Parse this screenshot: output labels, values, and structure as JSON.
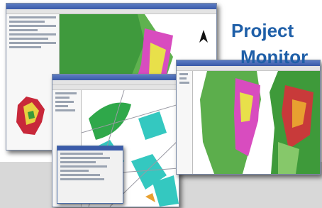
{
  "title": {
    "line1": "Project",
    "line2": "Monitor"
  },
  "colors": {
    "title": "#1f5fa8",
    "background_bar": "#d8d8d8",
    "window_title": "#3a5aa8"
  },
  "windows": [
    {
      "id": "gis-window-back",
      "content": "zoning-map",
      "has_north_arrow": true
    },
    {
      "id": "gis-window-middle",
      "content": "street-map",
      "has_dialog": true
    },
    {
      "id": "gis-window-front",
      "content": "land-use-map"
    }
  ]
}
